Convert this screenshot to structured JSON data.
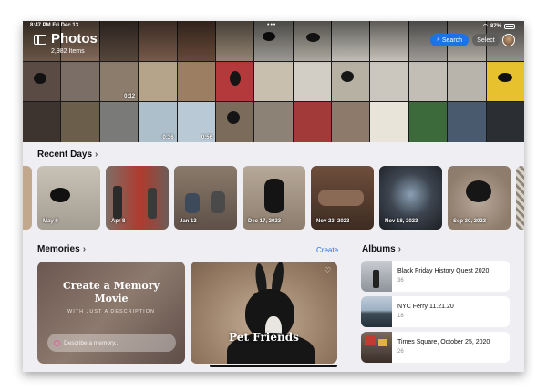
{
  "status_bar": {
    "time_date": "8:47 PM  Fri Dec 13",
    "battery": "87%"
  },
  "header": {
    "title": "Photos",
    "item_count": "2,982 Items",
    "search_label": "Search",
    "select_label": "Select"
  },
  "library": {
    "video_durations": [
      "0:12",
      "0:36",
      "0:56"
    ]
  },
  "recent_days": {
    "heading": "Recent Days",
    "items": [
      {
        "label": "May 9"
      },
      {
        "label": "Apr 8"
      },
      {
        "label": "Jan 13"
      },
      {
        "label": "Dec 17, 2023"
      },
      {
        "label": "Nov 23, 2023"
      },
      {
        "label": "Nov 18, 2023"
      },
      {
        "label": "Sep 30, 2023"
      }
    ]
  },
  "memories": {
    "heading": "Memories",
    "create_link": "Create",
    "create_card": {
      "title_line1": "Create a Memory",
      "title_line2": "Movie",
      "subtitle": "WITH JUST A DESCRIPTION",
      "input_placeholder": "Describe a memory..."
    },
    "featured_card": {
      "title": "Pet Friends"
    }
  },
  "albums": {
    "heading": "Albums",
    "items": [
      {
        "name": "Black Friday History Quest 2020",
        "count": "36"
      },
      {
        "name": "NYC Ferry 11.21.20",
        "count": "18"
      },
      {
        "name": "Times Square, October 25, 2020",
        "count": "26"
      }
    ]
  },
  "colors": {
    "accent": "#1a73e8",
    "background": "#efeef3"
  }
}
